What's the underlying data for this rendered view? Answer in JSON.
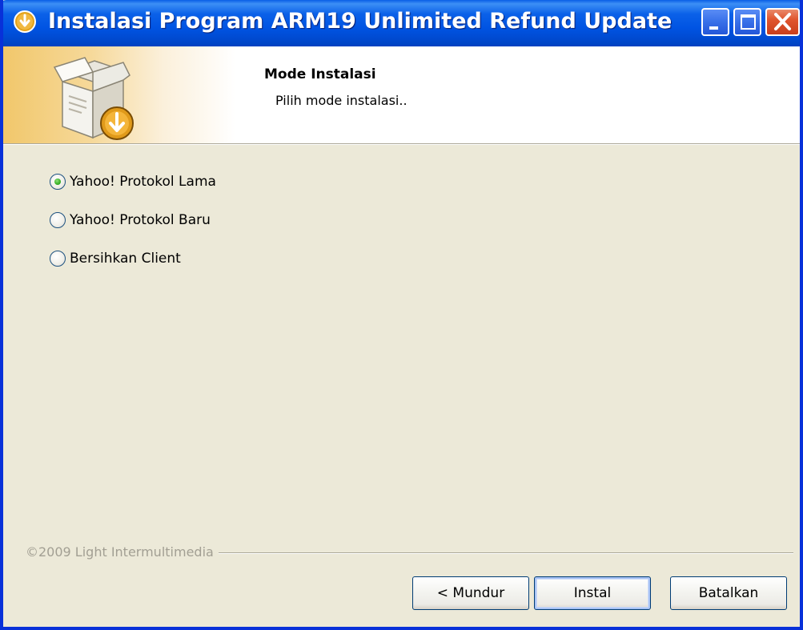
{
  "window": {
    "title": "Instalasi Program ARM19 Unlimited Refund Update",
    "title_icon": "setup-icon"
  },
  "title_buttons": {
    "minimize": "minimize-icon",
    "maximize": "maximize-icon",
    "close": "close-icon"
  },
  "header": {
    "icon": "installer-box-icon",
    "title": "Mode Instalasi",
    "subtitle": "Pilih mode instalasi.."
  },
  "options": [
    {
      "label": "Yahoo! Protokol Lama",
      "checked": true
    },
    {
      "label": "Yahoo! Protokol Baru",
      "checked": false
    },
    {
      "label": "Bersihkan Client",
      "checked": false
    }
  ],
  "footer": {
    "brand": "©2009 Light Intermultimedia"
  },
  "buttons": {
    "back": "< Mundur",
    "install": "Instal",
    "cancel": "Batalkan"
  },
  "colors": {
    "titlebar": "#0054e3",
    "window_bg": "#ece9d8",
    "radio_checked": "#3cb32a",
    "close_button": "#e0552e"
  }
}
